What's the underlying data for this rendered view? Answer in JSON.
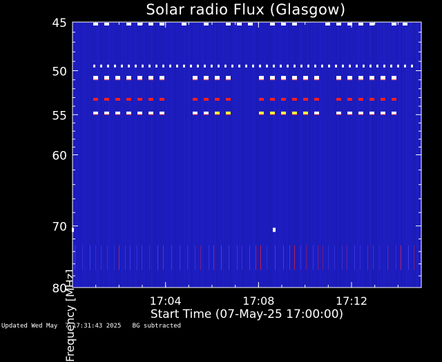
{
  "chart_data": {
    "type": "heatmap",
    "title": "Solar radio Flux (Glasgow)",
    "xlabel": "Start Time (07-May-25 17:00:00)",
    "ylabel": "Frequency [MHz]",
    "xlim": [
      "17:00",
      "17:15"
    ],
    "ylim": [
      45,
      80
    ],
    "y_scale": "log",
    "x_ticks": [
      "17:04",
      "17:08",
      "17:12"
    ],
    "y_ticks": [
      45,
      50,
      55,
      60,
      70,
      80
    ],
    "colors": {
      "background": "#1a1ab0",
      "noise": "#2a2aff",
      "hot": "#ff2020",
      "peak": "#ffffff",
      "mid": "#ffff40"
    },
    "bands": [
      {
        "freq_mhz": 45.2,
        "color": "peak"
      },
      {
        "freq_mhz": 49.5,
        "color": "peak"
      },
      {
        "freq_mhz": 50.8,
        "color": "peak"
      },
      {
        "freq_mhz": 53.2,
        "color": "hot"
      },
      {
        "freq_mhz": 54.8,
        "color": "peak"
      }
    ]
  },
  "footer": "Updated Wed May  7 17:31:43 2025   BG subtracted"
}
